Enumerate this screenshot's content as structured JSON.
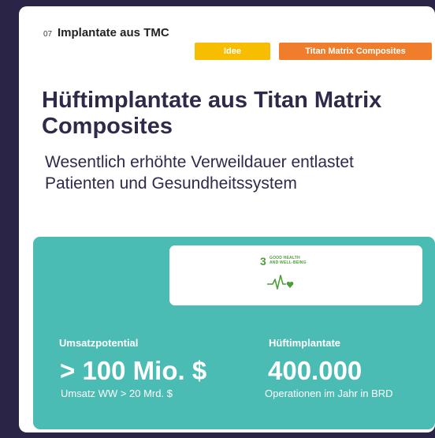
{
  "header": {
    "number": "07",
    "title": "Implantate aus TMC",
    "tags": [
      "Idee",
      "Titan Matrix Composites"
    ]
  },
  "main": {
    "title": "Hüftimplantate aus Titan Matrix Composites",
    "subtitle": "Wesentlich erhöhte Verweildauer entlastet Patienten und Gesundheitssystem"
  },
  "sdg": {
    "number": "3",
    "line1": "GOOD HEALTH",
    "line2": "AND WELL-BEING",
    "icon": "heartbeat-icon",
    "color": "#4c9f38"
  },
  "metrics": [
    {
      "label": "Umsatzpotential",
      "value": "> 100 Mio. $",
      "note": "Umsatz WW > 20 Mrd. $"
    },
    {
      "label": "Hüftimplantate",
      "value": "400.000",
      "note": "Operationen im Jahr in BRD"
    }
  ],
  "colors": {
    "background": "#2a2547",
    "panel": "#4bbcb3",
    "tag_idee": "#f7bd00",
    "tag_tmc": "#ef7d2c",
    "title": "#2d2a4a"
  }
}
